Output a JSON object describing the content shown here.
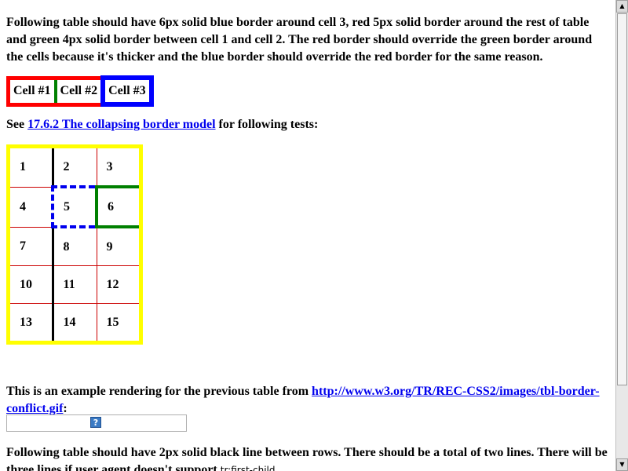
{
  "intro": "Following table should have 6px solid blue border around cell 3, red 5px solid border around the rest of table and green 4px solid border between cell 1 and cell 2. The red border should override the green border around the cells because it's thicker and the blue border should override the red border for the same reason.",
  "table1": [
    "Cell #1",
    "Cell #2",
    "Cell #3"
  ],
  "see": {
    "prefix": "See ",
    "link": "17.6.2 The collapsing border model",
    "suffix": " for following tests:"
  },
  "grid": [
    [
      "1",
      "2",
      "3"
    ],
    [
      "4",
      "5",
      "6"
    ],
    [
      "7",
      "8",
      "9"
    ],
    [
      "10",
      "11",
      "12"
    ],
    [
      "13",
      "14",
      "15"
    ]
  ],
  "example": {
    "prefix": "This is an example rendering for the previous table from ",
    "link": "http://www.w3.org/TR/REC-CSS2/images/tbl-border-conflict.gif",
    "suffix": ":"
  },
  "image_icon": "broken-image-icon",
  "following": {
    "text": "Following table should have 2px solid black line between rows. There should be a total of two lines. There will be three lines if user agent doesn't support ",
    "code": "tr:first-child",
    "suffix": "."
  },
  "colors": {
    "link": "#0000ee",
    "red_border": "#ff0000",
    "blue_border": "#0000ff",
    "green_border": "#008000",
    "yellow_border": "#ffff00"
  }
}
